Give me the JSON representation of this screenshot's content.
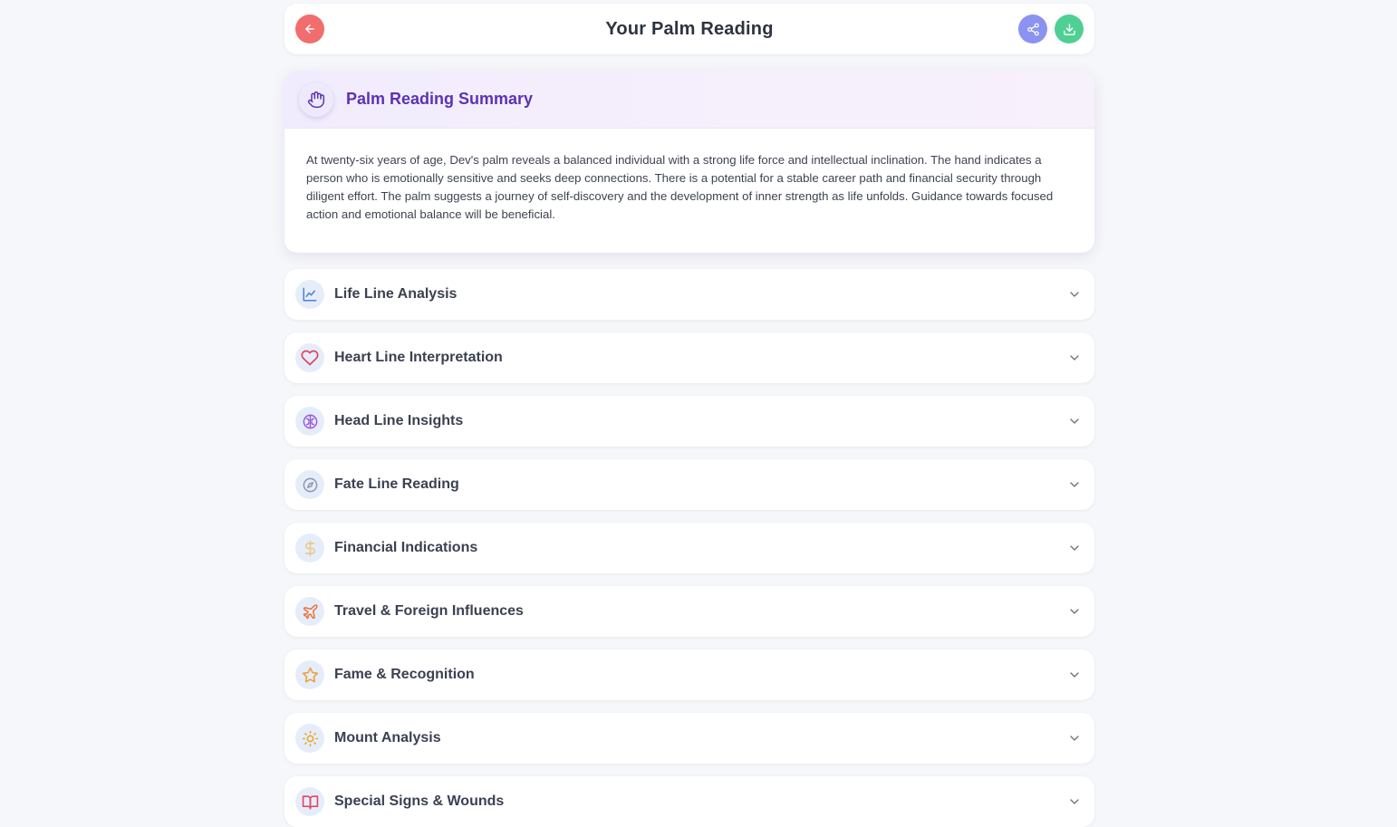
{
  "header": {
    "title": "Your Palm Reading"
  },
  "summary": {
    "title": "Palm Reading Summary",
    "text": "At twenty-six years of age, Dev's palm reveals a balanced individual with a strong life force and intellectual inclination. The hand indicates a person who is emotionally sensitive and seeks deep connections. There is a potential for a stable career path and financial security through diligent effort. The palm suggests a journey of self-discovery and the development of inner strength as life unfolds. Guidance towards focused action and emotional balance will be beneficial."
  },
  "sections": [
    {
      "label": "Life Line Analysis",
      "icon": "chart-line-icon",
      "color": "#4a7fd4"
    },
    {
      "label": "Heart Line Interpretation",
      "icon": "heart-icon",
      "color": "#e0455c"
    },
    {
      "label": "Head Line Insights",
      "icon": "brain-icon",
      "color": "#9a55e0"
    },
    {
      "label": "Fate Line Reading",
      "icon": "compass-icon",
      "color": "#8a93a8"
    },
    {
      "label": "Financial Indications",
      "icon": "dollar-icon",
      "color": "#e9c88a"
    },
    {
      "label": "Travel & Foreign Influences",
      "icon": "plane-icon",
      "color": "#e8733a"
    },
    {
      "label": "Fame & Recognition",
      "icon": "star-icon",
      "color": "#eea03a"
    },
    {
      "label": "Mount Analysis",
      "icon": "sun-icon",
      "color": "#e8a92a"
    },
    {
      "label": "Special Signs & Wounds",
      "icon": "book-icon",
      "color": "#e0455c"
    }
  ],
  "colors": {
    "back": "#f26d6d",
    "share": "#8b93f0",
    "download": "#4fcf94",
    "accent": "#5b32b4"
  }
}
